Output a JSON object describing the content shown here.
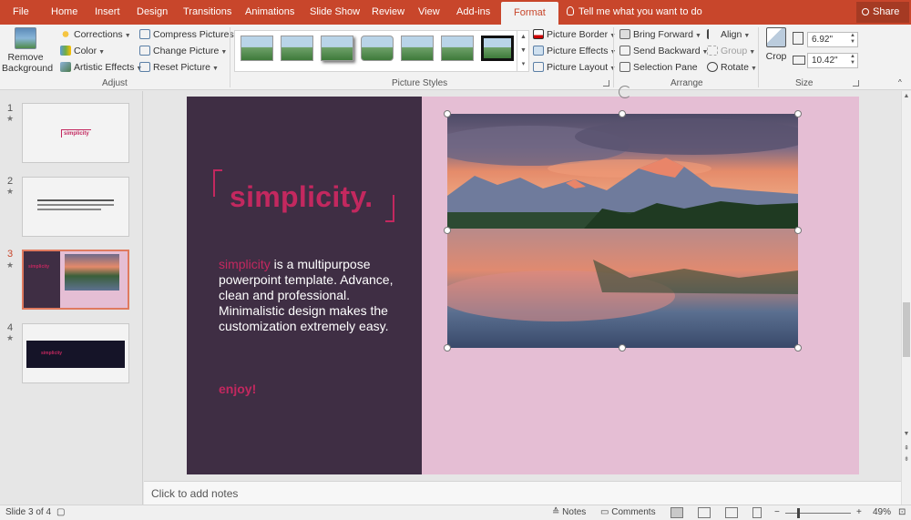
{
  "ribbon_tabs": [
    {
      "label": "File",
      "active": false
    },
    {
      "label": "Home",
      "active": false
    },
    {
      "label": "Insert",
      "active": false
    },
    {
      "label": "Design",
      "active": false
    },
    {
      "label": "Transitions",
      "active": false
    },
    {
      "label": "Animations",
      "active": false
    },
    {
      "label": "Slide Show",
      "active": false
    },
    {
      "label": "Review",
      "active": false
    },
    {
      "label": "View",
      "active": false
    },
    {
      "label": "Add-ins",
      "active": false
    },
    {
      "label": "Format",
      "active": true
    }
  ],
  "tell_me": "Tell me what you want to do",
  "share_label": "Share",
  "adjust": {
    "remove_background": "Remove Background",
    "corrections": "Corrections",
    "color": "Color",
    "artistic_effects": "Artistic Effects",
    "compress_pictures": "Compress Pictures",
    "change_picture": "Change Picture",
    "reset_picture": "Reset Picture",
    "group_label": "Adjust"
  },
  "picture_styles": {
    "gallery_count": 7,
    "selected_index": 6,
    "picture_border": "Picture Border",
    "picture_effects": "Picture Effects",
    "picture_layout": "Picture Layout",
    "group_label": "Picture Styles"
  },
  "arrange": {
    "bring_forward": "Bring Forward",
    "send_backward": "Send Backward",
    "selection_pane": "Selection Pane",
    "align": "Align",
    "group": "Group",
    "rotate": "Rotate",
    "group_label": "Arrange"
  },
  "size": {
    "crop": "Crop",
    "height": "6.92\"",
    "width": "10.42\"",
    "group_label": "Size"
  },
  "slides": [
    {
      "number": "1",
      "mini_title": "simplicity",
      "active": false
    },
    {
      "number": "2",
      "active": false
    },
    {
      "number": "3",
      "mini_title": "simplicity",
      "active": true
    },
    {
      "number": "4",
      "mini_title": "simplicity",
      "active": false
    }
  ],
  "current_slide": {
    "title": "simplicity.",
    "body_accent": "simplicity",
    "body_text": " is a multipurpose powerpoint template. Advance, clean and professional. Minimalistic design makes the customization extremely easy.",
    "enjoy": "enjoy!"
  },
  "notes_placeholder": "Click to add notes",
  "status": {
    "slide_info": "Slide 3 of 4",
    "notes_label": "Notes",
    "comments_label": "Comments",
    "zoom": "49%"
  },
  "colors": {
    "accent": "#c8462b",
    "slide_dark": "#3f2e44",
    "slide_pink": "#e5bed4",
    "title_pink": "#c3285f"
  }
}
